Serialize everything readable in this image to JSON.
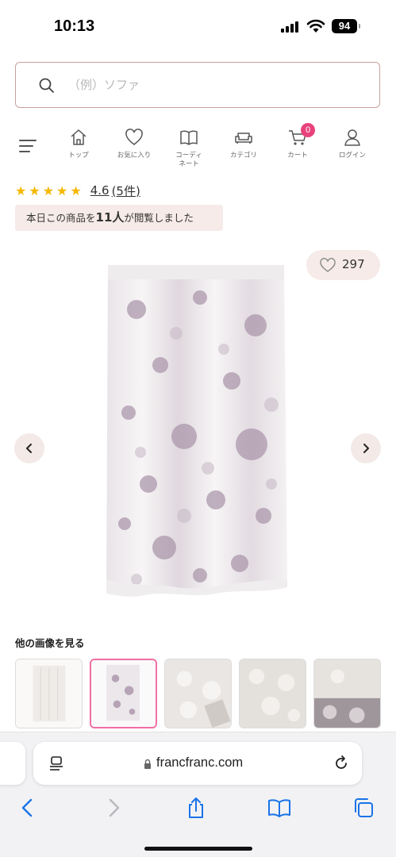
{
  "status_bar": {
    "time": "10:13",
    "battery": "94"
  },
  "search": {
    "placeholder": "（例）ソファ"
  },
  "nav": {
    "items": [
      {
        "label": "トップ",
        "icon": "home-icon"
      },
      {
        "label": "お気に入り",
        "icon": "heart-icon"
      },
      {
        "label": "コーディネート",
        "icon": "book-icon"
      },
      {
        "label": "カテゴリ",
        "icon": "sofa-icon"
      },
      {
        "label": "カート",
        "icon": "cart-icon"
      },
      {
        "label": "ログイン",
        "icon": "user-icon"
      }
    ],
    "cart_count": "0"
  },
  "product": {
    "rating_stars": "★★★★★",
    "rating_value": "4.6",
    "review_count": "(5件)",
    "viewers_prefix": "本日この商品を",
    "viewers_count": "11人",
    "viewers_suffix": "が閲覧しました",
    "like_count": "297",
    "more_images_title": "他の画像を見る",
    "thumbnail_count": 5,
    "selected_thumbnail_index": 1
  },
  "browser": {
    "url": "francfranc.com"
  },
  "colors": {
    "accent_pink": "#e8427c",
    "selected_border": "#f06fa5",
    "star": "#f5b800",
    "banner_bg": "#f6ebe8",
    "link_blue": "#1a73e8"
  }
}
